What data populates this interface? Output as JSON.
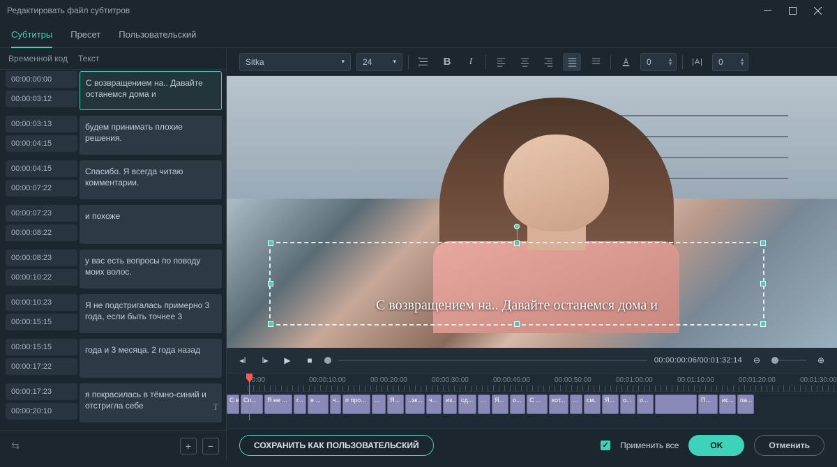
{
  "window": {
    "title": "Редактировать файл субтитров"
  },
  "tabs": {
    "t1": "Субтитры",
    "t2": "Пресет",
    "t3": "Пользовательский"
  },
  "cols": {
    "c1": "Временной код",
    "c2": "Текст"
  },
  "subs": [
    {
      "in": "00:00:00:00",
      "out": "00:00:03:12",
      "txt": "С возвращением на.. Давайте останемся дома и",
      "sel": true
    },
    {
      "in": "00:00:03:13",
      "out": "00:00:04:15",
      "txt": "будем принимать плохие решения."
    },
    {
      "in": "00:00:04:15",
      "out": "00:00:07:22",
      "txt": "Спасибо. Я всегда читаю комментарии."
    },
    {
      "in": "00:00:07:23",
      "out": "00:00:08:22",
      "txt": "и похоже"
    },
    {
      "in": "00:00:08:23",
      "out": "00:00:10:22",
      "txt": "у вас есть вопросы по поводу моих волос."
    },
    {
      "in": "00:00:10:23",
      "out": "00:00:15:15",
      "txt": "Я не подстригалась примерно 3 года, если быть точнее 3"
    },
    {
      "in": "00:00:15:15",
      "out": "00:00:17:22",
      "txt": "года и 3 месяца. 2 года назад"
    },
    {
      "in": "00:00:17:23",
      "out": "00:00:20:10",
      "txt": "я покрасилась в тёмно-синий и отстригла себе"
    }
  ],
  "toolbar": {
    "font": "Sitka",
    "size": "24",
    "spacing": "0",
    "other": "0"
  },
  "preview": {
    "subtitle": "С возвращением на.. Давайте останемся дома и"
  },
  "controls": {
    "time": "00:00:00:06/00:01:32:14"
  },
  "ruler": [
    "00:00",
    "00:00:10:00",
    "00:00:20:00",
    "00:00:30:00",
    "00:00:40:00",
    "00:00:50:00",
    "00:01:00:00",
    "00:01:10:00",
    "00:01:20:00",
    "00:01:30:00"
  ],
  "clips": [
    {
      "w": 18,
      "t": "С в..."
    },
    {
      "w": 32,
      "t": "Сп..."
    },
    {
      "w": 40,
      "t": "Я не ..."
    },
    {
      "w": 18,
      "t": "г..."
    },
    {
      "w": 30,
      "t": "я ..."
    },
    {
      "w": 16,
      "t": "ч..."
    },
    {
      "w": 40,
      "t": "п про..."
    },
    {
      "w": 20,
      "t": "..."
    },
    {
      "w": 24,
      "t": "Я..."
    },
    {
      "w": 28,
      "t": "..эк..."
    },
    {
      "w": 22,
      "t": "ч..."
    },
    {
      "w": 20,
      "t": "из..."
    },
    {
      "w": 26,
      "t": "сд..."
    },
    {
      "w": 18,
      "t": "..."
    },
    {
      "w": 24,
      "t": "Я..."
    },
    {
      "w": 22,
      "t": "о..."
    },
    {
      "w": 30,
      "t": "С ..."
    },
    {
      "w": 28,
      "t": "кот..."
    },
    {
      "w": 18,
      "t": "..."
    },
    {
      "w": 24,
      "t": "см,"
    },
    {
      "w": 24,
      "t": "Я..."
    },
    {
      "w": 22,
      "t": "о..."
    },
    {
      "w": 24,
      "t": "о..."
    },
    {
      "w": 60,
      "t": ""
    },
    {
      "w": 28,
      "t": "П..."
    },
    {
      "w": 24,
      "t": "ис..."
    },
    {
      "w": 24,
      "t": "па..."
    }
  ],
  "footer": {
    "save": "СОХРАНИТЬ КАК ПОЛЬЗОВАТЕЛЬСКИЙ",
    "apply": "Применить все",
    "ok": "OK",
    "cancel": "Отменить"
  }
}
